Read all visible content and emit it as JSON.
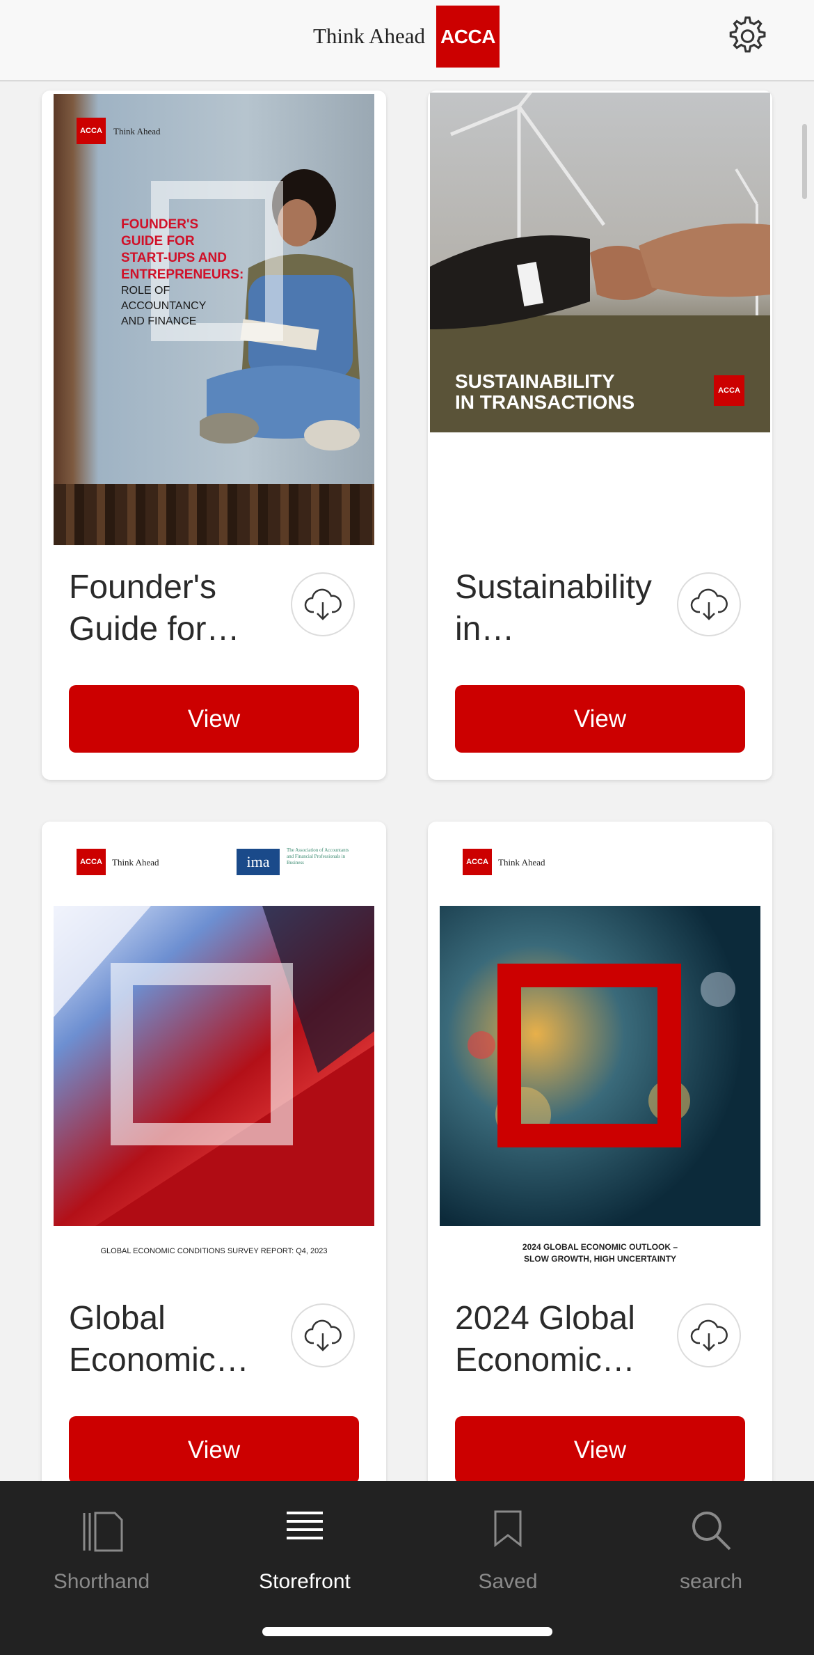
{
  "header": {
    "brand_text": "Think Ahead",
    "brand_logo": "ACCA",
    "settings_icon": "gear-icon"
  },
  "cards": [
    {
      "cover": {
        "logo": "ACCA",
        "tagline": "Think Ahead",
        "title_lines": [
          "FOUNDER'S",
          "GUIDE FOR",
          "START-UPS AND",
          "ENTREPRENEURS:"
        ],
        "subtitle_lines": [
          "ROLE OF",
          "ACCOUNTANCY",
          "AND FINANCE"
        ]
      },
      "title": "Founder's Guide for…",
      "download_icon": "cloud-download-icon",
      "view_label": "View"
    },
    {
      "cover": {
        "title_lines": [
          "SUSTAINABILITY",
          "IN TRANSACTIONS"
        ],
        "logo": "ACCA"
      },
      "title": "Sustainability in…",
      "download_icon": "cloud-download-icon",
      "view_label": "View"
    },
    {
      "cover": {
        "logo": "ACCA",
        "tagline": "Think Ahead",
        "partner_logo": "ima",
        "partner_text": "The Association of Accountants and Financial Professionals in Business",
        "caption": "GLOBAL ECONOMIC CONDITIONS SURVEY REPORT: Q4, 2023"
      },
      "title": "Global Economic…",
      "download_icon": "cloud-download-icon",
      "view_label": "View"
    },
    {
      "cover": {
        "logo": "ACCA",
        "tagline": "Think Ahead",
        "caption_line1": "2024 GLOBAL ECONOMIC OUTLOOK –",
        "caption_line2": "SLOW GROWTH, HIGH UNCERTAINTY"
      },
      "title": "2024 Global Economic…",
      "download_icon": "cloud-download-icon",
      "view_label": "View"
    }
  ],
  "tabs": [
    {
      "label": "Shorthand",
      "icon": "document-stack-icon",
      "active": false
    },
    {
      "label": "Storefront",
      "icon": "list-lines-icon",
      "active": true
    },
    {
      "label": "Saved",
      "icon": "bookmark-icon",
      "active": false
    },
    {
      "label": "search",
      "icon": "search-icon",
      "active": false
    }
  ],
  "colors": {
    "accent": "#cc0000",
    "tabbar_bg": "#222222",
    "page_bg": "#f2f2f2"
  }
}
